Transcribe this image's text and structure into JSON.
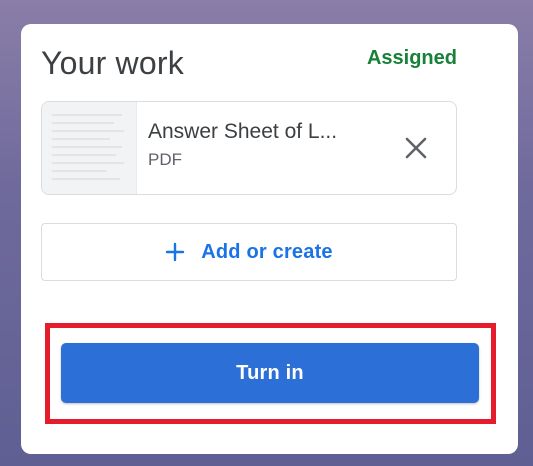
{
  "colors": {
    "status_green": "#188038",
    "accent_blue": "#1a73e8",
    "primary_button": "#2c6fd6",
    "highlight_red": "#e51c2c"
  },
  "work_card": {
    "title": "Your work",
    "status": "Assigned",
    "attachment": {
      "name": "Answer Sheet of L...",
      "type": "PDF",
      "thumbnail_icon": "document-thumbnail",
      "remove_icon": "close-icon"
    },
    "add_button": {
      "icon": "plus-icon",
      "label": "Add or create"
    },
    "turn_in_button": {
      "label": "Turn in"
    }
  }
}
